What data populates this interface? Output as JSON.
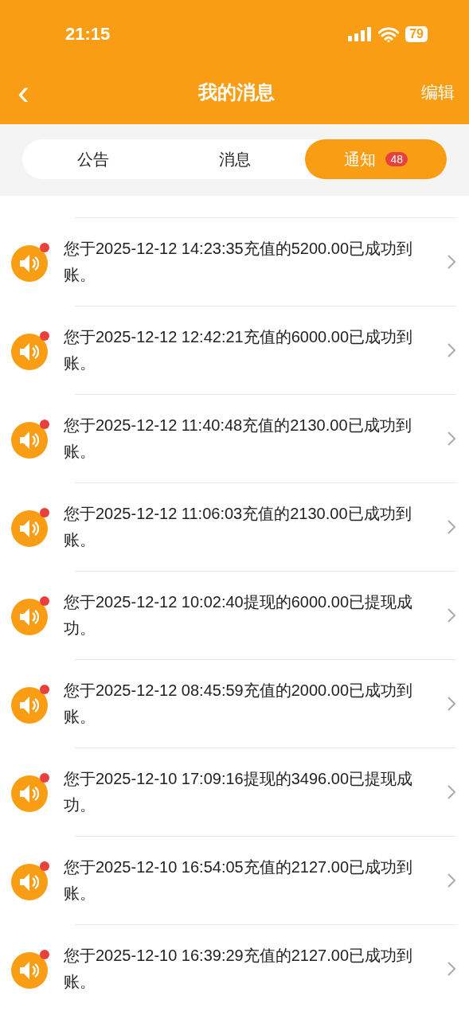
{
  "status_bar": {
    "time": "21:15",
    "battery": "79"
  },
  "nav": {
    "back": "‹",
    "title": "我的消息",
    "action": "编辑"
  },
  "tabs": [
    {
      "label": "公告",
      "selected": false
    },
    {
      "label": "消息",
      "selected": false
    },
    {
      "label": "通知",
      "selected": true,
      "badge": "48"
    }
  ],
  "notices": [
    {
      "text": "您于2025-12-12 14:23:35充值的5200.00已成功到账。",
      "unread": true
    },
    {
      "text": "您于2025-12-12 12:42:21充值的6000.00已成功到账。",
      "unread": true
    },
    {
      "text": "您于2025-12-12 11:40:48充值的2130.00已成功到账。",
      "unread": true
    },
    {
      "text": "您于2025-12-12 11:06:03充值的2130.00已成功到账。",
      "unread": true
    },
    {
      "text": "您于2025-12-12 10:02:40提现的6000.00已提现成功。",
      "unread": true
    },
    {
      "text": "您于2025-12-12 08:45:59充值的2000.00已成功到账。",
      "unread": true
    },
    {
      "text": "您于2025-12-10 17:09:16提现的3496.00已提现成功。",
      "unread": true
    },
    {
      "text": "您于2025-12-10 16:54:05充值的2127.00已成功到账。",
      "unread": true
    },
    {
      "text": "您于2025-12-10 16:39:29充值的2127.00已成功到账。",
      "unread": true
    }
  ]
}
